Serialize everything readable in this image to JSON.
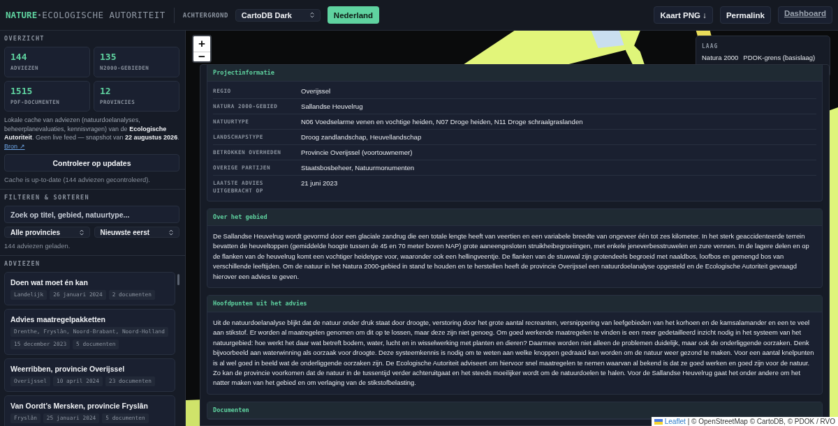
{
  "header": {
    "brand": "NATURE",
    "subtitle": "ECOLOGISCHE AUTORITEIT",
    "background_label": "ACHTERGROND",
    "background_select": "CartoDB Dark",
    "region_button": "Nederland",
    "buttons": [
      "Kaart PNG ↓",
      "Permalink"
    ],
    "dashboard_link": "Dashboard"
  },
  "sidebar": {
    "overview_title": "OVERZICHT",
    "stats": [
      {
        "value": "144",
        "label": "ADVIEZEN"
      },
      {
        "value": "135",
        "label": "N2000-GEBIEDEN"
      },
      {
        "value": "1515",
        "label": "PDF-DOCUMENTEN"
      },
      {
        "value": "12",
        "label": "PROVINCIES"
      }
    ],
    "description": "Lokale cache van adviezen (natuurdoelanalyses, beheerplanevaluaties, kennisvragen) van de **Ecologische Autoriteit**. Geen live feed — snapshot van **22 augustus 2026**.",
    "source_link": "Bron ↗",
    "update_button": "Controleer op updates",
    "cache_status": "Cache is up-to-date (144 adviezen gecontroleerd).",
    "filter_title": "FILTEREN & SORTEREN",
    "search": {
      "placeholder": "Zoek op titel, gebied, natuurtype..."
    },
    "province_select": "Alle provincies",
    "sort_select": "Nieuwste eerst",
    "loaded_count": "144 adviezen geladen.",
    "advice_title": "ADVIEZEN",
    "advices": [
      {
        "title": "Doen wat moet én kan",
        "tags": [
          "Landelijk",
          "26 januari 2024",
          "2 documenten"
        ]
      },
      {
        "title": "Advies maatregelpakketten",
        "tags": [
          "Drenthe, Fryslân, Noord-Brabant, Noord-Holland",
          "15 december 2023",
          "5 documenten"
        ]
      },
      {
        "title": "Weerribben, provincie Overijssel",
        "tags": [
          "Overijssel",
          "10 april 2024",
          "23 documenten"
        ]
      },
      {
        "title": "Van Oordt’s Mersken, provincie Fryslân",
        "tags": [
          "Fryslân",
          "25 januari 2024",
          "5 documenten"
        ]
      }
    ]
  },
  "map": {
    "zoom_in": "+",
    "zoom_out": "−",
    "legend": {
      "title": "LAAG",
      "items": [
        "Natura 2000",
        "PDOK-grens (basislaag)"
      ]
    },
    "attribution": {
      "link": "Leaflet",
      "text": "| © OpenStreetMap © CartoDB, © PDOK / RVO"
    }
  },
  "panel": {
    "sections": [
      {
        "title": "Projectinformatie",
        "kind": "table",
        "rows": [
          {
            "label": "REGIO",
            "value": "Overijssel"
          },
          {
            "label": "NATURA 2000-GEBIED",
            "value": "Sallandse Heuvelrug"
          },
          {
            "label": "NATUURTYPE",
            "value": "N06 Voedselarme venen en vochtige heiden, N07 Droge heiden, N11 Droge schraalgraslanden"
          },
          {
            "label": "LANDSCHAPSTYPE",
            "value": "Droog zandlandschap, Heuvellandschap"
          },
          {
            "label": "BETROKKEN OVERHEDEN",
            "value": "Provincie Overijssel (voortouwnemer)"
          },
          {
            "label": "OVERIGE PARTIJEN",
            "value": "Staatsbosbeheer, Natuurmonumenten"
          },
          {
            "label": "LAATSTE ADVIES UITGEBRACHT OP",
            "value": "21 juni 2023"
          }
        ]
      },
      {
        "title": "Over het gebied",
        "kind": "text",
        "text": "De Sallandse Heuvelrug wordt gevormd door een glaciale zandrug die een totale lengte heeft van veertien en een variabele breedte van ongeveer één tot zes kilometer. In het sterk geaccidenteerde terrein bevatten de heuveltoppen (gemiddelde hoogte tussen de 45 en 70 meter boven NAP) grote aaneengesloten struikheibegroeiingen, met enkele jeneverbesstruwelen en zure vennen. In de lagere delen en op de flanken van de heuvelrug komt een vochtiger heidetype voor, waaronder ook een hellingveentje. De flanken van de stuwwal zijn grotendeels begroeid met naaldbos, loofbos en gemengd bos van verschillende leeftijden. Om de natuur in het Natura 2000-gebied in stand te houden en te herstellen heeft de provincie Overijssel een natuurdoelanalyse opgesteld en de Ecologische Autoriteit gevraagd hierover een advies te geven."
      },
      {
        "title": "Hoofdpunten uit het advies",
        "kind": "text",
        "text": "Uit de natuurdoelanalyse blijkt dat de natuur onder druk staat door droogte, verstoring door het grote aantal recreanten, versnippering van leefgebieden van het korhoen en de kamsalamander en een te veel aan stikstof. Er worden al maatregelen genomen om dit op te lossen, maar deze zijn niet genoeg. Om goed werkende maatregelen te vinden is een meer gedetailleerd inzicht nodig in het systeem van het natuurgebied: hoe werkt het daar wat betreft bodem, water, lucht en in wisselwerking met planten en dieren? Daarmee worden niet alleen de problemen duidelijk, maar ook de onderliggende oorzaken. Denk bijvoorbeeld aan waterwinning als oorzaak voor droogte. Deze systeemkennis is nodig om te weten aan welke knoppen gedraaid kan worden om de natuur weer gezond te maken. Voor een aantal knelpunten is al wel goed in beeld wat de onderliggende oorzaken zijn. De Ecologische Autoriteit adviseert om hiervoor snel maatregelen te nemen waarvan al bekend is dat ze goed werken en goed zijn voor de natuur. Zo kan de provincie voorkomen dat de natuur in de tussentijd verder achteruitgaat en het steeds moeilijker wordt om de natuurdoelen te halen. Voor de Sallandse Heuvelrug gaat het onder andere om het natter maken van het gebied en om verlaging van de stikstofbelasting."
      },
      {
        "title": "Documenten",
        "kind": "text"
      }
    ]
  }
}
